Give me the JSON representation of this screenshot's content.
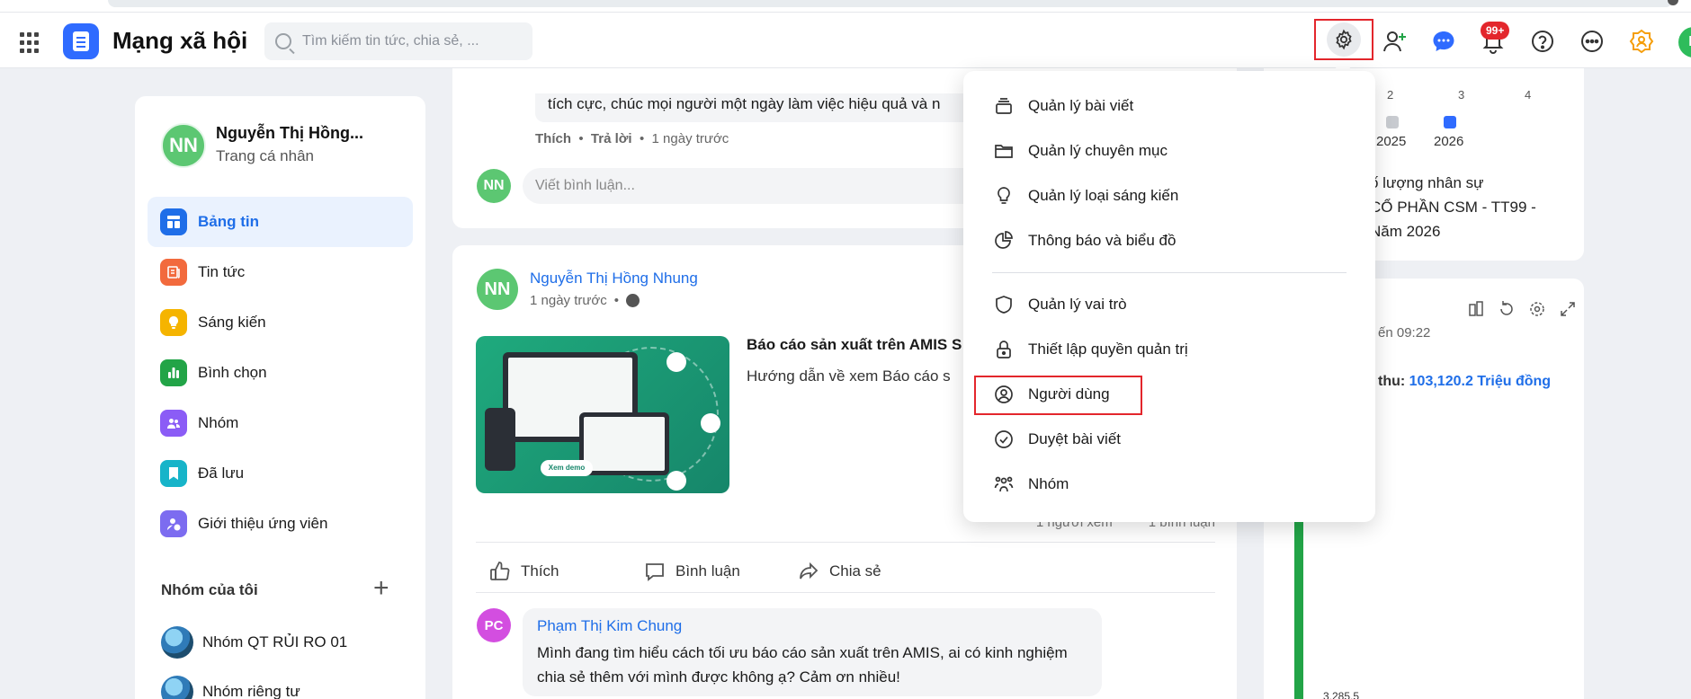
{
  "app": {
    "title": "Mạng xã hội"
  },
  "search": {
    "placeholder": "Tìm kiếm tin tức, chia sẻ, ..."
  },
  "topbar": {
    "notification_count": "99+",
    "user_initial": "N"
  },
  "profile": {
    "initials": "NN",
    "name": "Nguyễn Thị Hồng...",
    "subtitle": "Trang cá nhân"
  },
  "nav": [
    {
      "label": "Bảng tin",
      "icon": "newsfeed-icon",
      "color": "#1f6ee8"
    },
    {
      "label": "Tin tức",
      "icon": "news-icon",
      "color": "#f26a3d"
    },
    {
      "label": "Sáng kiến",
      "icon": "lightbulb-icon",
      "color": "#f5b400"
    },
    {
      "label": "Bình chọn",
      "icon": "poll-icon",
      "color": "#22a447"
    },
    {
      "label": "Nhóm",
      "icon": "group-icon",
      "color": "#8b5cf6"
    },
    {
      "label": "Đã lưu",
      "icon": "bookmark-icon",
      "color": "#17b4c9"
    },
    {
      "label": "Giới thiệu ứng viên",
      "icon": "refer-candidate-icon",
      "color": "#7c6cf0"
    }
  ],
  "my_groups": {
    "header": "Nhóm của tôi",
    "items": [
      {
        "label": "Nhóm QT RỦI RO 01"
      },
      {
        "label": "Nhóm riêng tư"
      }
    ]
  },
  "card1": {
    "text": "tích cực, chúc mọi người một ngày làm việc hiệu quả và n",
    "like": "Thích",
    "reply": "Trả lời",
    "time": "1 ngày trước",
    "commenter_initials": "NN",
    "comment_placeholder": "Viết bình luận..."
  },
  "post": {
    "author_initials": "NN",
    "author": "Nguyễn Thị Hồng Nhung",
    "time": "1 ngày trước",
    "title": "Báo cáo sản xuất trên AMIS S",
    "description": "Hướng dẫn về xem Báo cáo s",
    "image_button": "Xem demo",
    "views": "1 người xem",
    "comments": "1 bình luận",
    "actions": {
      "like": "Thích",
      "comment": "Bình luận",
      "share": "Chia sẻ"
    },
    "reply": {
      "initials": "PC",
      "name": "Phạm Thị Kim Chung",
      "text": "Mình đang tìm hiểu cách tối ưu báo cáo sản xuất trên AMIS, ai có kinh nghiệm chia sẻ thêm với mình được không ạ? Cảm ơn nhiều!"
    }
  },
  "right1": {
    "ticks": [
      "2",
      "3",
      "4"
    ],
    "legend": [
      {
        "label": "2025",
        "color": "#c8cbd0"
      },
      {
        "label": "2026",
        "color": "#2f6bff"
      }
    ],
    "title_line1": "ố lượng nhân sự",
    "title_line2": "CỔ PHẦN CSM - TT99 -",
    "title_line3": "Năm 2026"
  },
  "right2": {
    "time": "ến 09:22",
    "revenue_label": "thu:",
    "revenue_value": "103,120.2 Triệu đồng",
    "bar_value": "3,285.5",
    "bar_color": "#22a447"
  },
  "settings_menu": {
    "items": [
      {
        "label": "Quản lý bài viết",
        "icon": "stack-icon"
      },
      {
        "label": "Quản lý chuyên mục",
        "icon": "folder-icon"
      },
      {
        "label": "Quản lý loại sáng kiến",
        "icon": "lightbulb-outline-icon"
      },
      {
        "label": "Thông báo và biểu đồ",
        "icon": "pie-chart-icon"
      },
      {
        "label": "Quản lý vai trò",
        "icon": "shield-icon"
      },
      {
        "label": "Thiết lập quyền quản trị",
        "icon": "lock-icon"
      },
      {
        "label": "Người dùng",
        "icon": "user-circle-icon"
      },
      {
        "label": "Duyệt bài viết",
        "icon": "check-circle-icon"
      },
      {
        "label": "Nhóm",
        "icon": "users-icon"
      }
    ]
  },
  "colors": {
    "highlight": "#e3262c",
    "accent": "#1f6ee8",
    "brand": "#2f6bff"
  }
}
